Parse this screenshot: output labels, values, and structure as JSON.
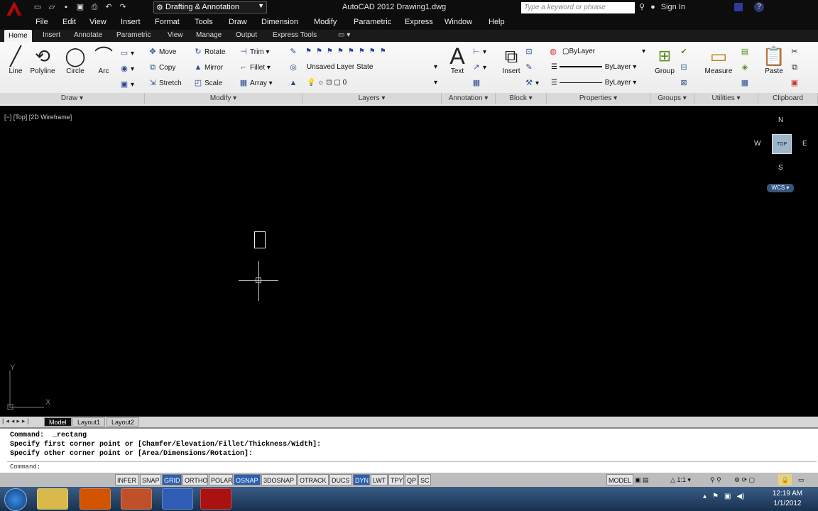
{
  "titlebar": {
    "workspace": "Drafting & Annotation",
    "window_title": "AutoCAD 2012   Drawing1.dwg",
    "search_placeholder": "Type a keyword or phrase",
    "sign_in": "Sign In"
  },
  "menu": [
    "File",
    "Edit",
    "View",
    "Insert",
    "Format",
    "Tools",
    "Draw",
    "Dimension",
    "Modify",
    "Parametric",
    "Express",
    "Window",
    "Help"
  ],
  "ribbon_tabs": [
    "Home",
    "Insert",
    "Annotate",
    "Parametric",
    "View",
    "Manage",
    "Output",
    "Express Tools"
  ],
  "draw_panel": {
    "line": "Line",
    "polyline": "Polyline",
    "circle": "Circle",
    "arc": "Arc",
    "footer": "Draw ▾"
  },
  "modify_panel": {
    "move": "Move",
    "rotate": "Rotate",
    "trim": "Trim ▾",
    "copy": "Copy",
    "mirror": "Mirror",
    "fillet": "Fillet ▾",
    "stretch": "Stretch",
    "scale": "Scale",
    "array": "Array ▾",
    "footer": "Modify ▾"
  },
  "layers_panel": {
    "layer_state": "Unsaved Layer State",
    "current_layer": "0",
    "footer": "Layers ▾"
  },
  "annotation_panel": {
    "text": "Text",
    "footer": "Annotation ▾"
  },
  "block_panel": {
    "insert": "Insert",
    "footer": "Block ▾"
  },
  "properties_panel": {
    "color": "ByLayer",
    "linetype": "ByLayer",
    "lineweight": "ByLayer",
    "footer": "Properties ▾"
  },
  "groups_panel": {
    "group": "Group",
    "footer": "Groups ▾"
  },
  "utilities_panel": {
    "measure": "Measure",
    "footer": "Utilities ▾"
  },
  "clipboard_panel": {
    "paste": "Paste",
    "footer": "Clipboard"
  },
  "viewport": {
    "label": "[−] [Top] [2D Wireframe]",
    "compass": {
      "n": "N",
      "s": "S",
      "e": "E",
      "w": "W",
      "top": "TOP"
    },
    "wcs": "WCS ▾",
    "ucs_x": "X",
    "ucs_y": "Y"
  },
  "layout_tabs": [
    "Model",
    "Layout1",
    "Layout2"
  ],
  "command": {
    "lines": [
      "Command:  _rectang",
      "Specify first corner point or [Chamfer/Elevation/Fillet/Thickness/Width]:",
      "Specify other corner point or [Area/Dimensions/Rotation]:"
    ],
    "prompt": "Command:"
  },
  "status_toggles": [
    {
      "label": "INFER",
      "on": false
    },
    {
      "label": "SNAP",
      "on": false
    },
    {
      "label": "GRID",
      "on": true
    },
    {
      "label": "ORTHO",
      "on": false
    },
    {
      "label": "POLAR",
      "on": false
    },
    {
      "label": "OSNAP",
      "on": true
    },
    {
      "label": "3DOSNAP",
      "on": false
    },
    {
      "label": "OTRACK",
      "on": false
    },
    {
      "label": "DUCS",
      "on": false
    },
    {
      "label": "DYN",
      "on": true
    },
    {
      "label": "LWT",
      "on": false
    },
    {
      "label": "TPY",
      "on": false
    },
    {
      "label": "QP",
      "on": false
    },
    {
      "label": "SC",
      "on": false
    }
  ],
  "status_right": {
    "model": "MODEL",
    "scale": "1:1 ▾"
  },
  "clock": {
    "time": "12:19 AM",
    "date": "1/1/2012"
  },
  "colors": {
    "accent": "#2b5fb0",
    "titlebar": "#0d0d0d",
    "canvas": "#000000"
  }
}
